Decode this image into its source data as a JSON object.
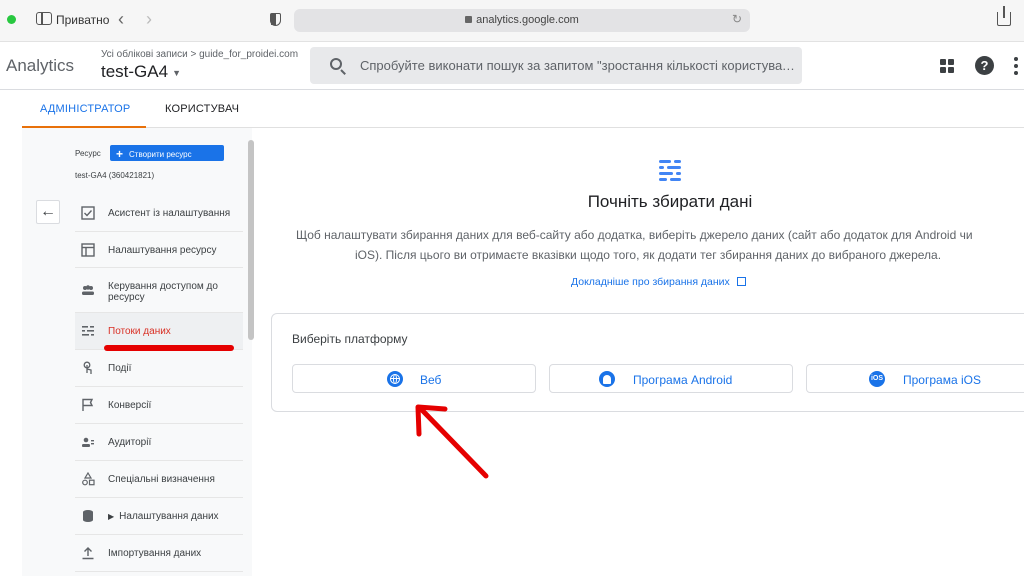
{
  "browser": {
    "private_label": "Приватно",
    "url": "analytics.google.com"
  },
  "header": {
    "logo": "Analytics",
    "breadcrumb": "Усі облікові записи > guide_for_proidei.com",
    "property_name": "test-GA4",
    "search_placeholder": "Спробуйте виконати пошук за запитом \"зростання кількості користувачів\""
  },
  "tabs": {
    "admin": "АДМІНІСТРАТОР",
    "user": "КОРИСТУВАЧ"
  },
  "left": {
    "resource_label": "Ресурс",
    "create_button": "Створити ресурс",
    "property_id": "test-GA4 (360421821)",
    "items": [
      {
        "label": "Асистент із налаштування",
        "icon": "checkbox-icon"
      },
      {
        "label": "Налаштування ресурсу",
        "icon": "layout-icon"
      },
      {
        "label": "Керування доступом до ресурсу",
        "icon": "people-icon"
      },
      {
        "label": "Потоки даних",
        "icon": "streams-icon",
        "active": true
      },
      {
        "label": "Події",
        "icon": "touch-icon"
      },
      {
        "label": "Конверсії",
        "icon": "flag-icon"
      },
      {
        "label": "Аудиторії",
        "icon": "audience-icon"
      },
      {
        "label": "Спеціальні визначення",
        "icon": "shapes-icon"
      },
      {
        "label": "Налаштування даних",
        "icon": "database-icon"
      },
      {
        "label": "Імпортування даних",
        "icon": "upload-icon"
      }
    ]
  },
  "main": {
    "title": "Почніть збирати дані",
    "description_line1": "Щоб налаштувати збирання даних для веб-сайту або додатка, виберіть джерело даних (сайт або додаток для Android чи",
    "description_line2": "iOS). Після цього ви отримаєте вказівки щодо того, як додати тег збирання даних до вибраного джерела.",
    "learn_more": "Докладніше про збирання даних",
    "platform_title": "Виберіть платформу",
    "platforms": {
      "web": "Веб",
      "android": "Програма Android",
      "ios": "Програма iOS",
      "ios_badge": "iOS"
    }
  },
  "colors": {
    "accent": "#1a73e8",
    "tab_underline": "#e8710a",
    "annotation_red": "#e50000",
    "active_nav": "#d93025"
  }
}
